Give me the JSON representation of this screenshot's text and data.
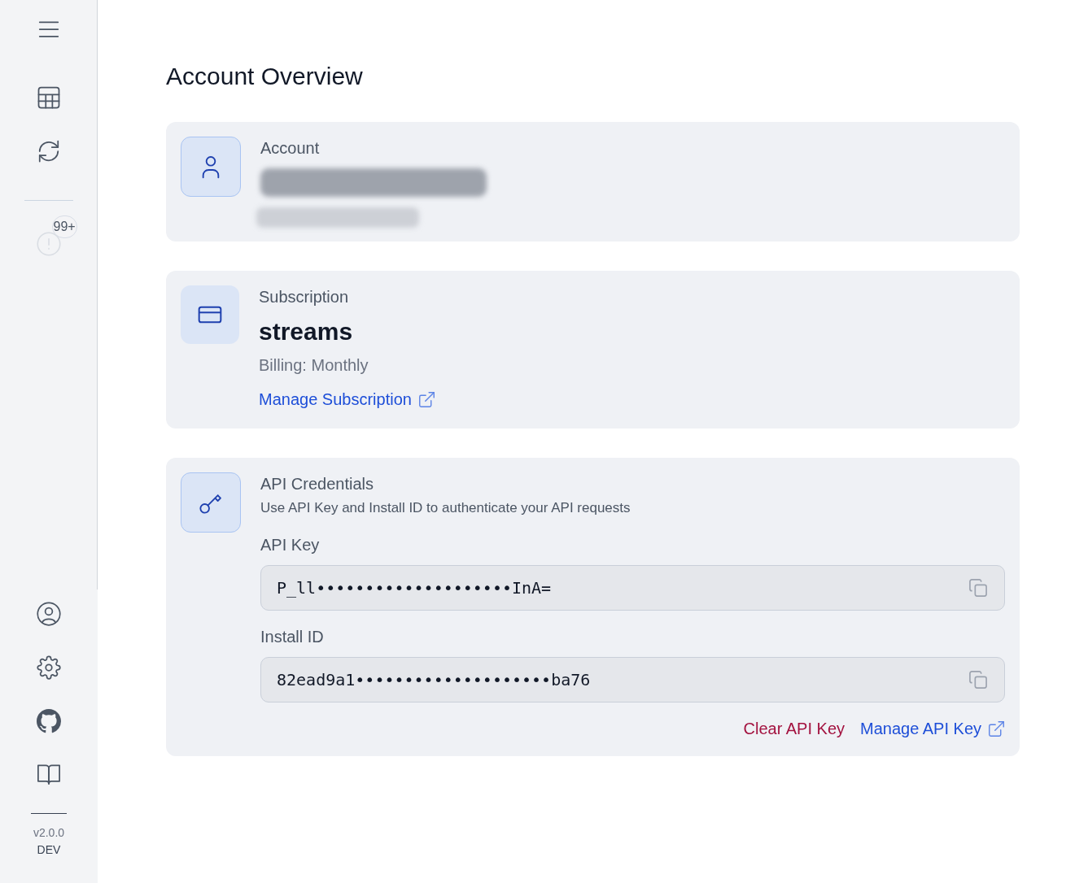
{
  "sidebar": {
    "notification_badge": "99+",
    "version": "v2.0.0",
    "build": "DEV"
  },
  "page_title": "Account Overview",
  "account": {
    "label": "Account"
  },
  "subscription": {
    "label": "Subscription",
    "plan": "streams",
    "billing": "Billing: Monthly",
    "link": "Manage Subscription"
  },
  "api_credentials": {
    "label": "API Credentials",
    "description": "Use API Key and Install ID to authenticate your API requests",
    "fields": [
      {
        "label": "API Key",
        "value": "P_ll••••••••••••••••••••InA="
      },
      {
        "label": "Install ID",
        "value": "82ead9a1••••••••••••••••••••ba76"
      }
    ],
    "actions": [
      {
        "label": "Clear API Key",
        "kind": "danger"
      },
      {
        "label": "Manage API Key",
        "kind": "external"
      }
    ]
  }
}
